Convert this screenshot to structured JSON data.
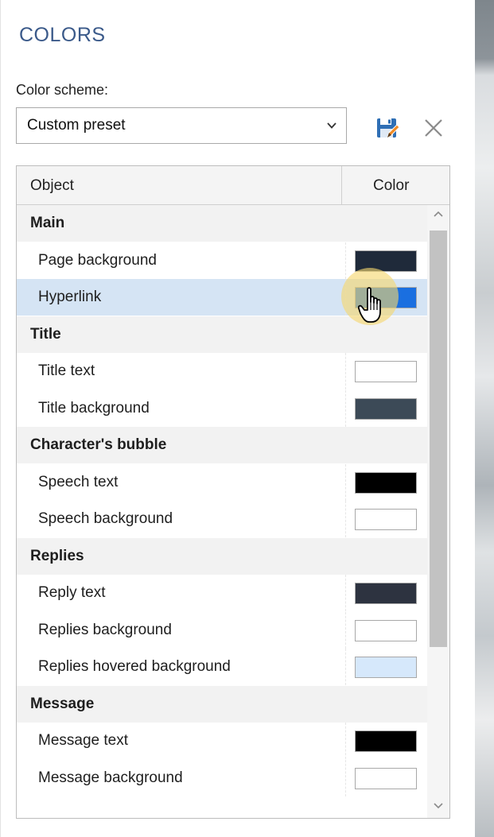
{
  "panel": {
    "title": "COLORS",
    "scheme_label": "Color scheme:",
    "scheme_value": "Custom preset",
    "save_icon": "save-preset-icon",
    "delete_icon": "close-icon"
  },
  "table": {
    "col_object": "Object",
    "col_color": "Color",
    "rows": [
      {
        "type": "group",
        "label": "Main"
      },
      {
        "type": "item",
        "label": "Page background",
        "color": "#1f2a3a"
      },
      {
        "type": "item",
        "label": "Hyperlink",
        "color": "#1a6fe0",
        "state": "hovered"
      },
      {
        "type": "group",
        "label": "Title"
      },
      {
        "type": "item",
        "label": "Title text",
        "color": "#ffffff"
      },
      {
        "type": "item",
        "label": "Title background",
        "color": "#3c4a57"
      },
      {
        "type": "group",
        "label": "Character's bubble"
      },
      {
        "type": "item",
        "label": "Speech text",
        "color": "#000000"
      },
      {
        "type": "item",
        "label": "Speech background",
        "color": "#ffffff"
      },
      {
        "type": "group",
        "label": "Replies"
      },
      {
        "type": "item",
        "label": "Reply text",
        "color": "#2d3340"
      },
      {
        "type": "item",
        "label": "Replies background",
        "color": "#ffffff"
      },
      {
        "type": "item",
        "label": "Replies hovered background",
        "color": "#d6e8fb"
      },
      {
        "type": "group",
        "label": "Message"
      },
      {
        "type": "item",
        "label": "Message text",
        "color": "#000000"
      },
      {
        "type": "item",
        "label": "Message background",
        "color": "#ffffff"
      }
    ]
  },
  "colors": {
    "title_text": "#3b5a8a",
    "hover_row": "#d5e4f4",
    "save_icon_blue": "#2f6fb5",
    "save_icon_pencil": "#f08a24"
  }
}
